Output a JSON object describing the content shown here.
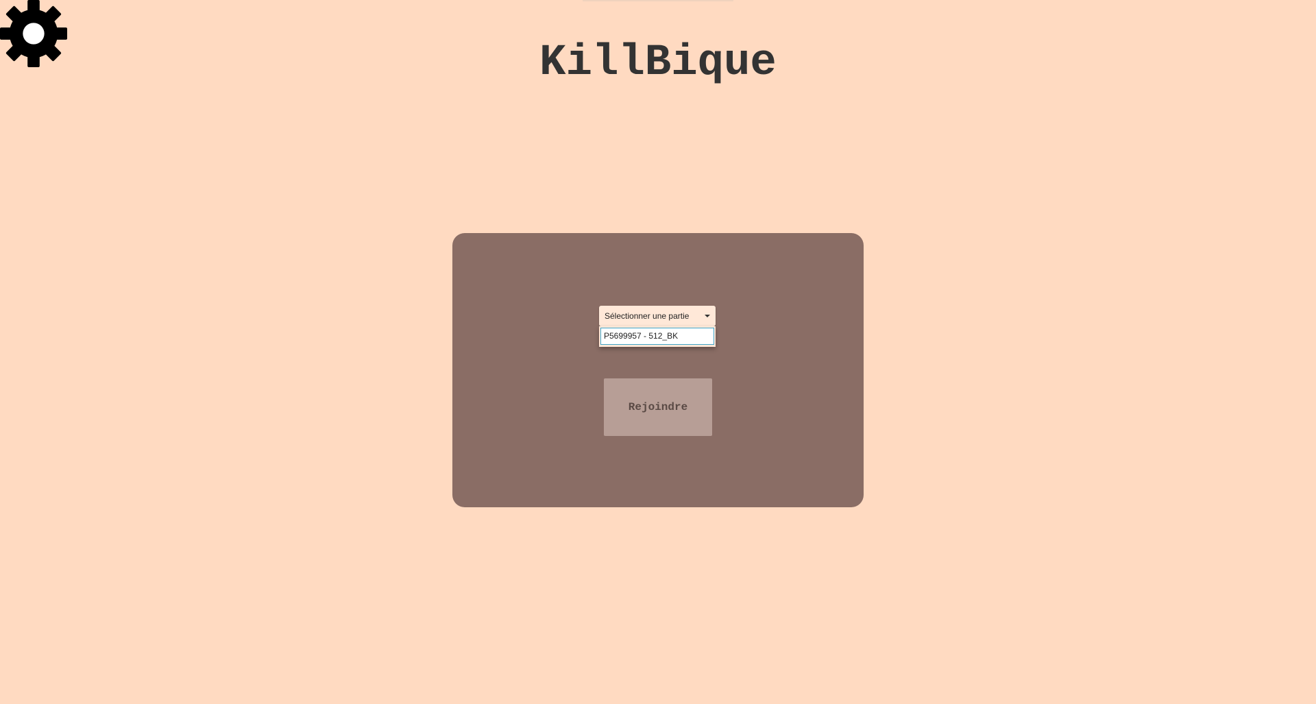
{
  "app": {
    "title": "KillBique"
  },
  "settings": {
    "icon": "gear-icon"
  },
  "join_panel": {
    "game_select": {
      "placeholder": "Sélectionner une partie",
      "options": [
        "P5699957 - 512_BK"
      ],
      "highlighted_option": "P5699957 - 512_BK"
    },
    "join_button_label": "Rejoindre"
  },
  "colors": {
    "background": "#FFDAC1",
    "panel": "#8A6D65",
    "button": "#B79E96",
    "title_text": "#333333",
    "option_focus_border": "#3FA4C8"
  }
}
